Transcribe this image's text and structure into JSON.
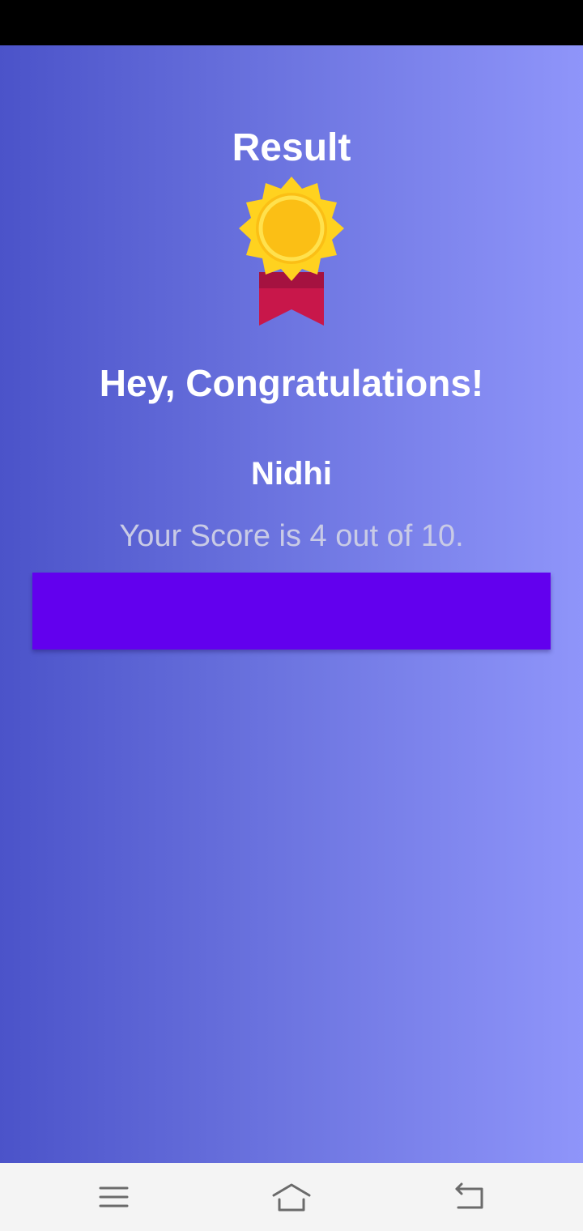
{
  "result": {
    "title": "Result",
    "medal_icon": "medal-icon",
    "congratulations": "Hey, Congratulations!",
    "user_name": "Nidhi",
    "score_text": "Your Score is 4 out of 10.",
    "score": 4,
    "total": 10
  },
  "action_button": {
    "label": "",
    "color": "#6200ee"
  },
  "nav_bar": {
    "items": [
      {
        "icon": "menu-icon"
      },
      {
        "icon": "home-icon"
      },
      {
        "icon": "back-icon"
      }
    ]
  },
  "colors": {
    "gradient_start": "#4b53c9",
    "gradient_end": "#8f95fa",
    "status_bar": "#000000",
    "medal_gold": "#ffc61a",
    "ribbon": "#c8174a"
  }
}
